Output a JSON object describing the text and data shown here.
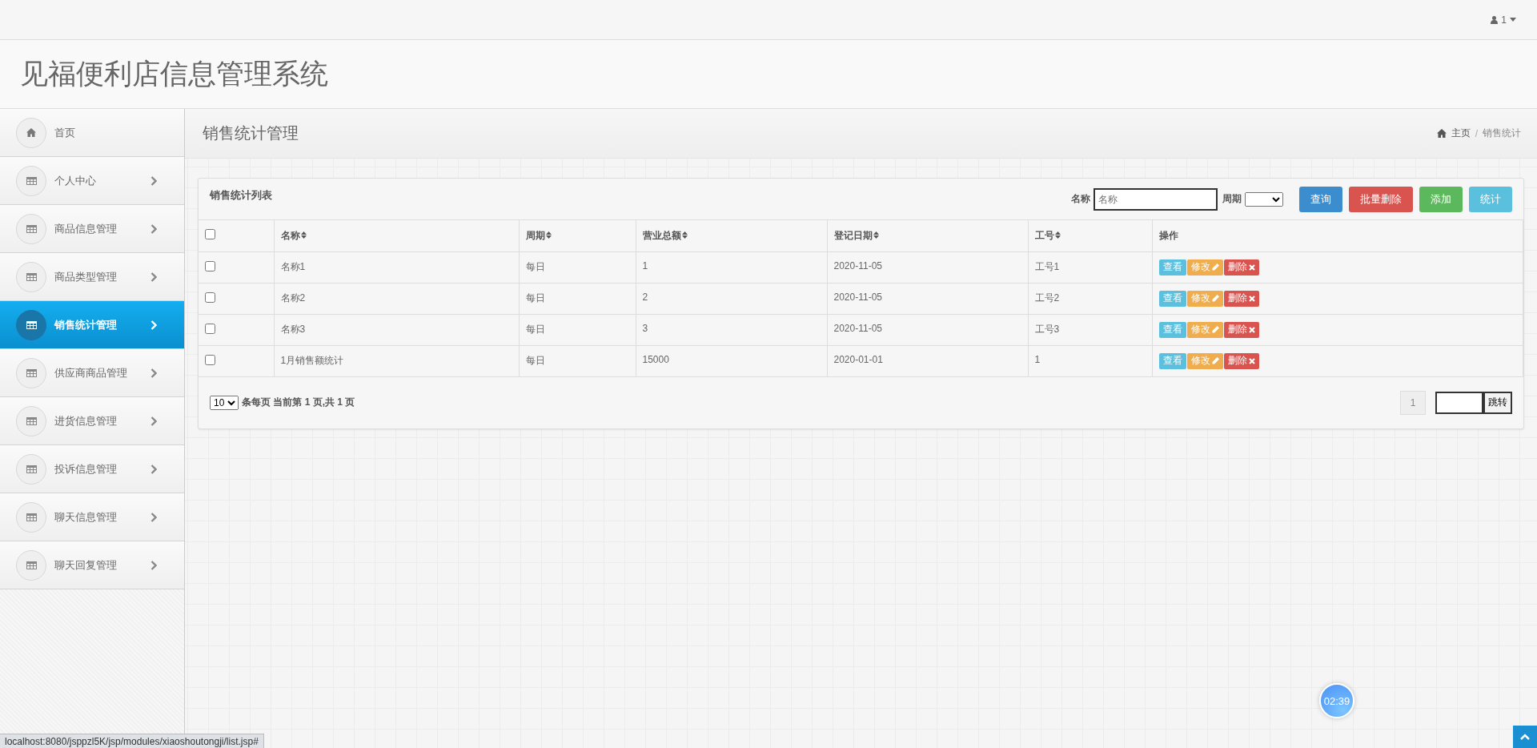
{
  "top_bar": {
    "user": "1"
  },
  "header": {
    "title": "见福便利店信息管理系统"
  },
  "sidebar": {
    "items": [
      {
        "label": "首页",
        "kind": "home",
        "selected": false
      },
      {
        "label": "个人中心",
        "kind": "grid",
        "selected": false
      },
      {
        "label": "商品信息管理",
        "kind": "grid",
        "selected": false
      },
      {
        "label": "商品类型管理",
        "kind": "grid",
        "selected": false
      },
      {
        "label": "销售统计管理",
        "kind": "grid",
        "selected": true
      },
      {
        "label": "供应商商品管理",
        "kind": "grid",
        "selected": false
      },
      {
        "label": "进货信息管理",
        "kind": "grid",
        "selected": false
      },
      {
        "label": "投诉信息管理",
        "kind": "grid",
        "selected": false
      },
      {
        "label": "聊天信息管理",
        "kind": "grid",
        "selected": false
      },
      {
        "label": "聊天回复管理",
        "kind": "grid",
        "selected": false
      }
    ]
  },
  "page_header": {
    "title": "销售统计管理",
    "breadcrumb": [
      "主页",
      "销售统计"
    ],
    "breadcrumb_separator": "/"
  },
  "panel": {
    "title": "销售统计列表",
    "filters": {
      "name_label": "名称",
      "name_placeholder": "名称",
      "period_label": "周期"
    },
    "buttons": [
      {
        "label": "查询",
        "kind": "primary"
      },
      {
        "label": "批量删除",
        "kind": "danger"
      },
      {
        "label": "添加",
        "kind": "success"
      },
      {
        "label": "统计",
        "kind": "info"
      }
    ],
    "table": {
      "columns": [
        {
          "label": "名称",
          "sortable": true
        },
        {
          "label": "周期",
          "sortable": true
        },
        {
          "label": "营业总额",
          "sortable": true
        },
        {
          "label": "登记日期",
          "sortable": true
        },
        {
          "label": "工号",
          "sortable": true
        },
        {
          "label": "操作",
          "sortable": false
        }
      ],
      "all_checked": false,
      "rows": [
        {
          "checked": false,
          "cells": [
            "名称1",
            "每日",
            "1",
            "2020-11-05",
            "工号1"
          ],
          "actions": [
            {
              "label": "查看",
              "kind": "info"
            },
            {
              "label": "修改",
              "kind": "edit"
            },
            {
              "label": "删除",
              "kind": "delete"
            }
          ]
        },
        {
          "checked": false,
          "cells": [
            "名称2",
            "每日",
            "2",
            "2020-11-05",
            "工号2"
          ],
          "actions": [
            {
              "label": "查看",
              "kind": "info"
            },
            {
              "label": "修改",
              "kind": "edit"
            },
            {
              "label": "删除",
              "kind": "delete"
            }
          ]
        },
        {
          "checked": false,
          "cells": [
            "名称3",
            "每日",
            "3",
            "2020-11-05",
            "工号3"
          ],
          "actions": [
            {
              "label": "查看",
              "kind": "info"
            },
            {
              "label": "修改",
              "kind": "edit"
            },
            {
              "label": "删除",
              "kind": "delete"
            }
          ]
        },
        {
          "checked": false,
          "cells": [
            "1月销售额统计",
            "每日",
            "15000",
            "2020-01-01",
            "1"
          ],
          "actions": [
            {
              "label": "查看",
              "kind": "info"
            },
            {
              "label": "修改",
              "kind": "edit"
            },
            {
              "label": "删除",
              "kind": "delete"
            }
          ]
        }
      ]
    },
    "pagination": {
      "page_size": "10",
      "summary": "条每页 当前第 1 页,共 1 页",
      "pages": [
        "1"
      ],
      "jump": "跳转"
    }
  },
  "timer": "02:39",
  "status_url": "localhost:8080/jsppzl5K/jsp/modules/xiaoshoutongji/list.jsp#"
}
